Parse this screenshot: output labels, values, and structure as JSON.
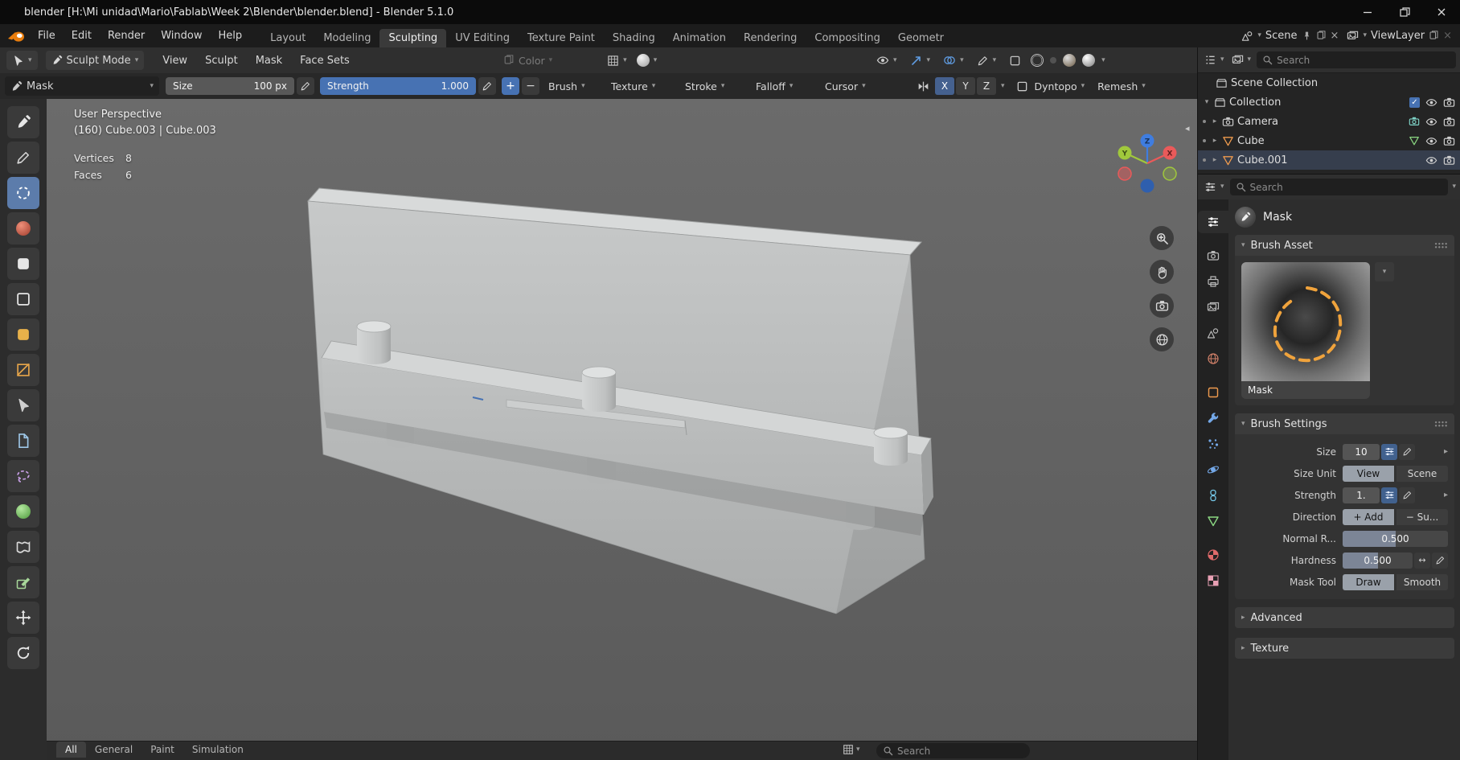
{
  "colors": {
    "accent_blue": "#4772b3",
    "axis_x": "#ea5a5a",
    "axis_y": "#a0c83c",
    "axis_z": "#3f7de0",
    "object_orange": "#ef9b4e",
    "data_green": "#8bd882",
    "viewport_bg": "#646464"
  },
  "window": {
    "title": "blender [H:\\Mi unidad\\Mario\\Fablab\\Week 2\\Blender\\blender.blend] - Blender 5.1.0"
  },
  "menubar": {
    "menus": [
      "File",
      "Edit",
      "Render",
      "Window",
      "Help"
    ],
    "workspaces": [
      "Layout",
      "Modeling",
      "Sculpting",
      "UV Editing",
      "Texture Paint",
      "Shading",
      "Animation",
      "Rendering",
      "Compositing",
      "Geometr"
    ],
    "active_workspace": "Sculpting",
    "scene_selector": {
      "label": "Scene"
    },
    "viewlayer_selector": {
      "label": "ViewLayer"
    }
  },
  "tool_header": {
    "mode": "Sculpt Mode",
    "menus": [
      "View",
      "Sculpt",
      "Mask",
      "Face Sets"
    ],
    "color_label": "Color"
  },
  "brush_header": {
    "brush_name": "Mask",
    "size_label": "Size",
    "size_value": "100 px",
    "strength_label": "Strength",
    "strength_value": "1.000",
    "popovers": [
      "Brush",
      "Texture",
      "Stroke",
      "Falloff",
      "Cursor"
    ],
    "symmetry_axes": [
      "X",
      "Y",
      "Z"
    ],
    "dyntopo_label": "Dyntopo",
    "remesh_label": "Remesh"
  },
  "toolbar": {
    "tools": [
      "Brush",
      "Paint",
      "Mask",
      "Draw Face Sets",
      "Box Hide",
      "Box Mask",
      "Lasso Mask",
      "Line Mask",
      "Box Trim",
      "Lasso Trim",
      "Line Project",
      "Mesh Filter",
      "Cloth Filter",
      "Color Filter",
      "Move",
      "Rotate"
    ],
    "active_tool": "Mask"
  },
  "viewport": {
    "view_label": "User Perspective",
    "object_info": "(160) Cube.003 | Cube.003",
    "stats": [
      {
        "label": "Vertices",
        "value": "8"
      },
      {
        "label": "Faces",
        "value": "6"
      }
    ],
    "gizmo": {
      "x": "X",
      "y": "Y",
      "z": "Z"
    }
  },
  "outliner": {
    "search_placeholder": "Search",
    "rows": [
      {
        "label": "Scene Collection"
      },
      {
        "label": "Collection"
      },
      {
        "label": "Camera"
      },
      {
        "label": "Cube"
      },
      {
        "label": "Cube.001"
      }
    ]
  },
  "properties": {
    "search_placeholder": "Search",
    "active_brush": "Mask",
    "tabs": [
      "tool",
      "render",
      "output",
      "view-layer",
      "scene",
      "world",
      "object",
      "modifiers",
      "particles",
      "physics",
      "constraints",
      "object-data",
      "material",
      "texture"
    ],
    "brush_asset": {
      "title": "Brush Asset",
      "preview_caption": "Mask"
    },
    "brush_settings": {
      "title": "Brush Settings",
      "size": {
        "label": "Size",
        "value": "10"
      },
      "size_unit": {
        "label": "Size Unit",
        "options": [
          "View",
          "Scene"
        ],
        "active": "View"
      },
      "strength": {
        "label": "Strength",
        "value": "1."
      },
      "direction": {
        "label": "Direction",
        "options": [
          "+ Add",
          "− Su..."
        ],
        "active": "+ Add"
      },
      "normal_radius": {
        "label": "Normal R...",
        "value": "0.500"
      },
      "hardness": {
        "label": "Hardness",
        "value": "0.500"
      },
      "mask_tool": {
        "label": "Mask Tool",
        "options": [
          "Draw",
          "Smooth"
        ],
        "active": "Draw"
      }
    },
    "advanced": {
      "title": "Advanced"
    },
    "texture": {
      "title": "Texture"
    }
  },
  "asset_shelf": {
    "tabs": [
      "All",
      "General",
      "Paint",
      "Simulation"
    ],
    "active_tab": "All",
    "search_placeholder": "Search"
  }
}
